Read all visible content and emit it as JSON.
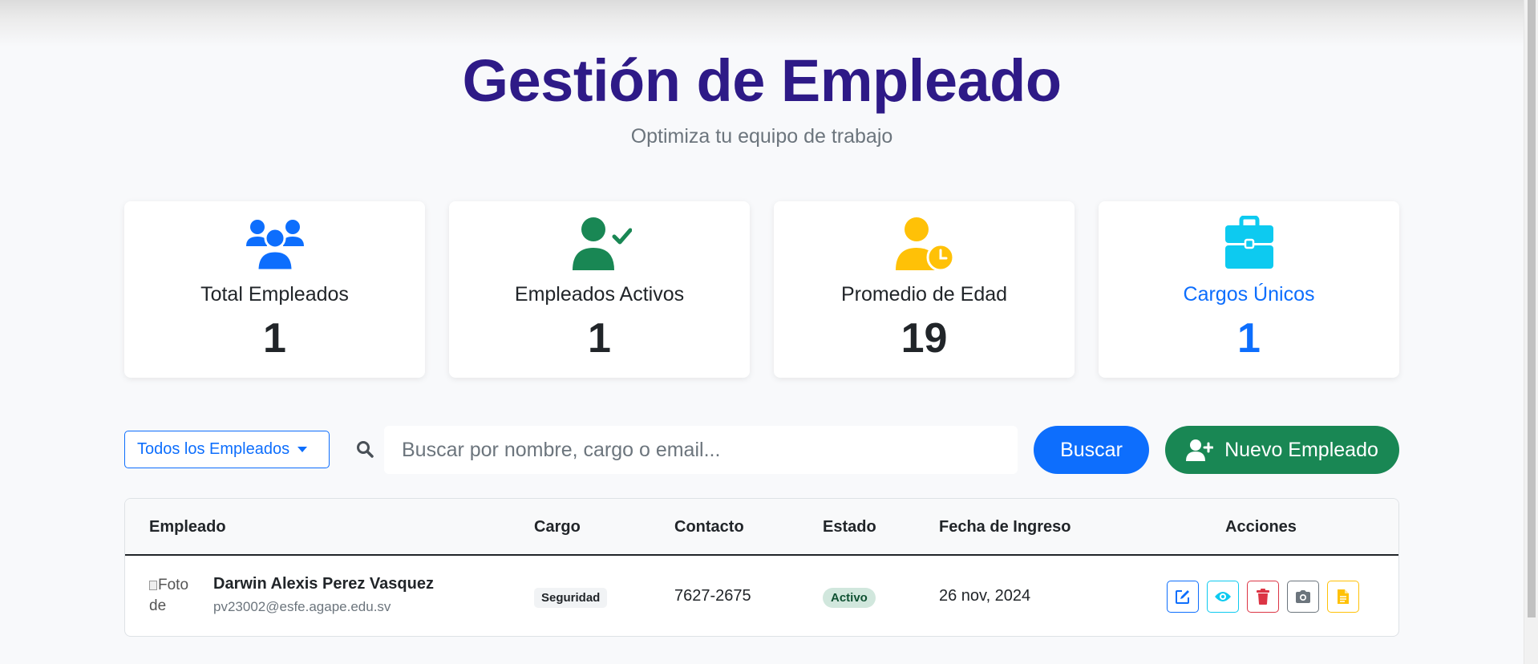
{
  "header": {
    "title": "Gestión de Empleado",
    "subtitle": "Optimiza tu equipo de trabajo"
  },
  "stats": [
    {
      "label": "Total Empleados",
      "value": "1",
      "icon": "users-icon",
      "color": "#0d6efd"
    },
    {
      "label": "Empleados Activos",
      "value": "1",
      "icon": "user-check-icon",
      "color": "#198754"
    },
    {
      "label": "Promedio de Edad",
      "value": "19",
      "icon": "user-clock-icon",
      "color": "#ffc107"
    },
    {
      "label": "Cargos Únicos",
      "value": "1",
      "icon": "briefcase-icon",
      "color": "#0dcaf0"
    }
  ],
  "toolbar": {
    "filter_label": "Todos los Empleados",
    "search_placeholder": "Buscar por nombre, cargo o email...",
    "search_button": "Buscar",
    "new_button": "Nuevo Empleado"
  },
  "table": {
    "headers": [
      "Empleado",
      "Cargo",
      "Contacto",
      "Estado",
      "Fecha de Ingreso",
      "Acciones"
    ],
    "rows": [
      {
        "photo_alt": "Foto de",
        "name": "Darwin Alexis Perez Vasquez",
        "email": "pv23002@esfe.agape.edu.sv",
        "cargo": "Seguridad",
        "contact": "7627-2675",
        "status": "Activo",
        "date": "26 nov, 2024"
      }
    ]
  },
  "colors": {
    "title": "#2e1a87",
    "primary": "#0d6efd",
    "success": "#198754",
    "warning": "#ffc107",
    "info": "#0dcaf0",
    "danger": "#dc3545",
    "secondary": "#6c757d"
  }
}
